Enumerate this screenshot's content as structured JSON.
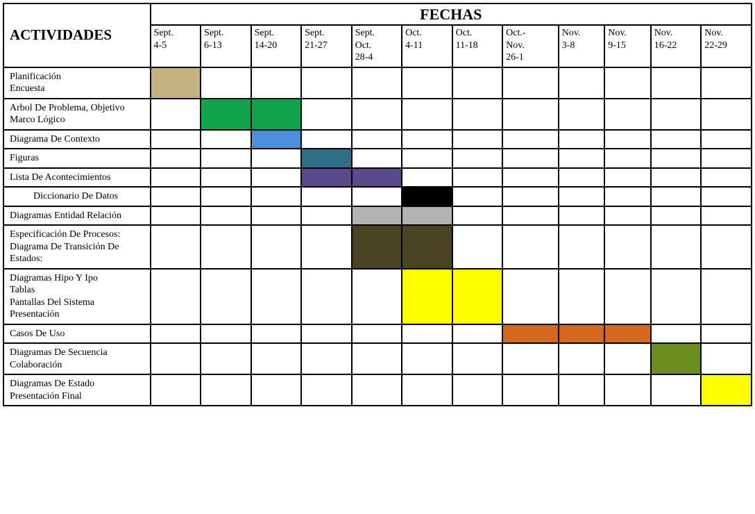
{
  "header": {
    "activities": "ACTIVIDADES",
    "dates_title": "FECHAS"
  },
  "chart_data": {
    "type": "gantt",
    "columns": [
      "Sept. 4-5",
      "Sept. 6-13",
      "Sept. 14-20",
      "Sept. 21-27",
      "Sept. Oct. 28-4",
      "Oct. 4-11",
      "Oct. 11-18",
      "Oct.- Nov. 26-1",
      "Nov. 3-8",
      "Nov. 9-15",
      "Nov. 16-22",
      "Nov. 22-29"
    ],
    "rows": [
      {
        "label": "Planificación\nEncuesta",
        "indent": false,
        "bars": [
          {
            "from": 0,
            "to": 0,
            "color": "#c2b280"
          }
        ]
      },
      {
        "label": "Arbol De Problema, Objetivo\n Marco Lógico",
        "indent": false,
        "bars": [
          {
            "from": 1,
            "to": 2,
            "color": "#13a34a"
          }
        ]
      },
      {
        "label": "Diagrama De Contexto",
        "indent": false,
        "bars": [
          {
            "from": 2,
            "to": 2,
            "color": "#4a90d9"
          }
        ]
      },
      {
        "label": "Figuras",
        "indent": false,
        "bars": [
          {
            "from": 3,
            "to": 3,
            "color": "#2f6f87"
          }
        ]
      },
      {
        "label": "Lista De Acontecimientos",
        "indent": false,
        "bars": [
          {
            "from": 3,
            "to": 4,
            "color": "#5a4a8a"
          }
        ]
      },
      {
        "label": "Diccionario De Datos",
        "indent": true,
        "bars": [
          {
            "from": 5,
            "to": 5,
            "color": "#000000"
          }
        ]
      },
      {
        "label": "Diagramas Entidad Relación",
        "indent": false,
        "bars": [
          {
            "from": 4,
            "to": 5,
            "color": "#b3b3b3"
          }
        ]
      },
      {
        "label": "Especificación De Procesos:\nDiagrama De Transición De\nEstados:",
        "indent": false,
        "bars": [
          {
            "from": 4,
            "to": 5,
            "color": "#4a4424"
          }
        ]
      },
      {
        "label": "Diagramas Hipo Y  Ipo\nTablas\nPantallas Del Sistema\nPresentación",
        "indent": false,
        "bars": [
          {
            "from": 5,
            "to": 6,
            "color": "#ffff00"
          }
        ]
      },
      {
        "label": "Casos De Uso",
        "indent": false,
        "bars": [
          {
            "from": 7,
            "to": 9,
            "color": "#d2691e"
          }
        ]
      },
      {
        "label": "Diagramas De Secuencia\nColaboración",
        "indent": false,
        "bars": [
          {
            "from": 10,
            "to": 10,
            "color": "#6b8e23"
          }
        ]
      },
      {
        "label": "Diagramas De Estado\nPresentación Final",
        "indent": false,
        "bars": [
          {
            "from": 11,
            "to": 11,
            "color": "#ffff00"
          }
        ]
      }
    ]
  }
}
